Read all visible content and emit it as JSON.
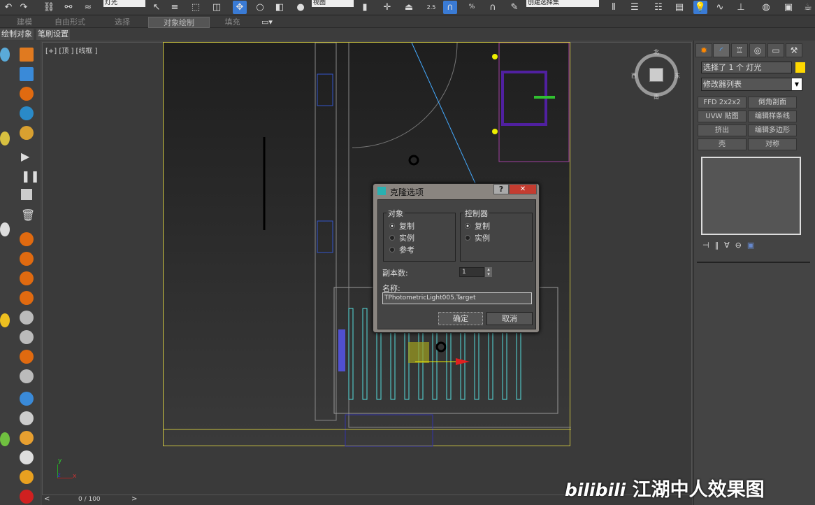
{
  "toolbar": {
    "layer_combo": "灯光",
    "view_combo": "视图",
    "selection_set": "创建选择集",
    "snap_value": "2.5",
    "percent_snap": "%"
  },
  "ribbon": {
    "tabs": [
      {
        "label": "建模"
      },
      {
        "label": "自由形式"
      },
      {
        "label": "选择"
      },
      {
        "label": "对象绘制",
        "active": true
      },
      {
        "label": "填充"
      }
    ]
  },
  "subtabs": [
    {
      "label": "绘制对象"
    },
    {
      "label": "笔刷设置"
    }
  ],
  "viewport": {
    "label": "[+] [顶 ] [线框 ]",
    "compass": {
      "n": "北",
      "s": "南",
      "e": "东",
      "w": "西"
    },
    "axis_x": "x",
    "axis_y": "y",
    "axis_z": "z"
  },
  "dialog": {
    "title": "克隆选项",
    "help": "?",
    "close": "✕",
    "object_group": {
      "title": "对象",
      "options": [
        "复制",
        "实例",
        "参考"
      ],
      "selected": 0
    },
    "controller_group": {
      "title": "控制器",
      "options": [
        "复制",
        "实例"
      ],
      "selected": 0
    },
    "copies_label": "副本数:",
    "copies_value": "1",
    "name_label": "名称:",
    "name_value": "TPhotometricLight005.Target",
    "ok": "确定",
    "cancel": "取消"
  },
  "command_panel": {
    "selection_text": "选择了 1 个 灯光",
    "selection_color": "#ffd800",
    "modifier_list": "修改器列表",
    "modifier_buttons": [
      "FFD 2x2x2",
      "倒角剖面",
      "UVW 贴图",
      "编辑样条线",
      "挤出",
      "编辑多边形",
      "壳",
      "对称"
    ]
  },
  "timeline": {
    "frame": "0 / 100",
    "prev": "<",
    "next": ">"
  },
  "watermark": {
    "logo": "bilibili",
    "text": "江湖中人效果图"
  }
}
